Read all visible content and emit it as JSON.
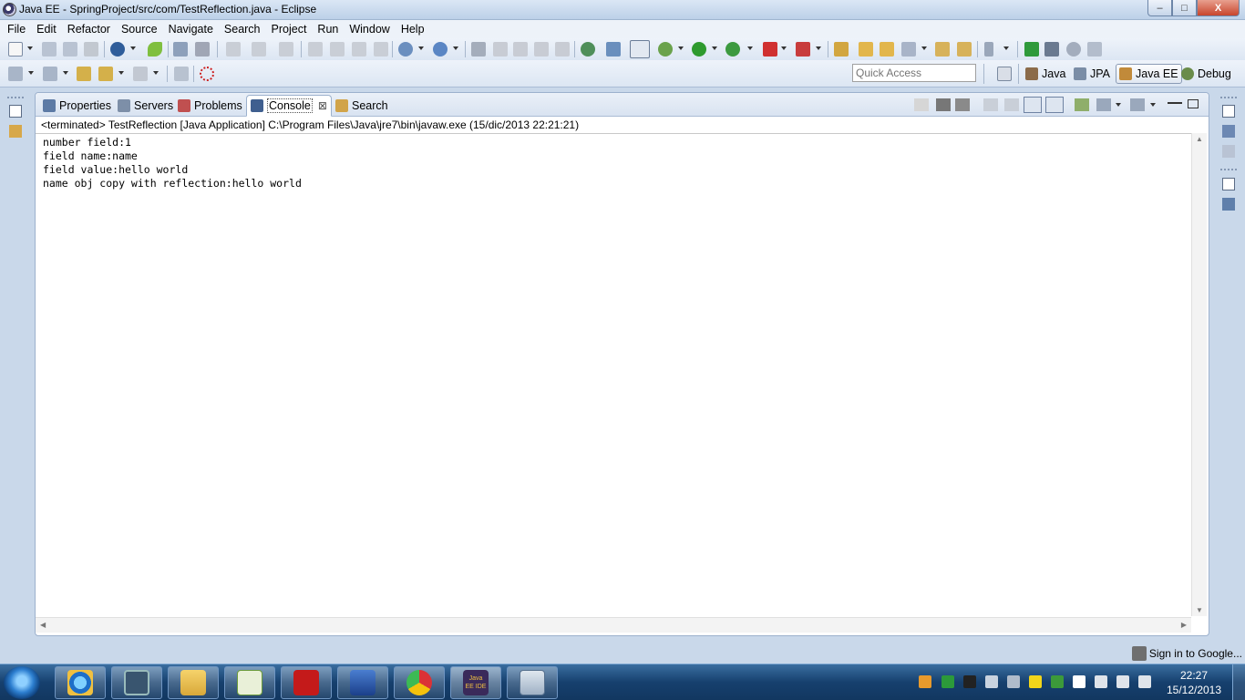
{
  "window": {
    "title": "Java EE - SpringProject/src/com/TestReflection.java - Eclipse",
    "controls": {
      "minimize": "–",
      "maximize": "□",
      "close": "X"
    }
  },
  "menu": [
    "File",
    "Edit",
    "Refactor",
    "Source",
    "Navigate",
    "Search",
    "Project",
    "Run",
    "Window",
    "Help"
  ],
  "toolbar": {
    "quick_access_placeholder": "Quick Access",
    "perspectives": [
      {
        "label": "Java",
        "icon": "java-perspective-icon",
        "active": false
      },
      {
        "label": "JPA",
        "icon": "jpa-perspective-icon",
        "active": false
      },
      {
        "label": "Java EE",
        "icon": "javaee-perspective-icon",
        "active": true
      },
      {
        "label": "Debug",
        "icon": "debug-perspective-icon",
        "active": false
      }
    ]
  },
  "views": {
    "tabs": [
      {
        "label": "Properties",
        "icon": "properties-icon",
        "active": false
      },
      {
        "label": "Servers",
        "icon": "servers-icon",
        "active": false
      },
      {
        "label": "Problems",
        "icon": "problems-icon",
        "active": false
      },
      {
        "label": "Console",
        "icon": "console-icon",
        "active": true
      },
      {
        "label": "Search",
        "icon": "search-icon",
        "active": false
      }
    ],
    "tab_close_glyph": "⊠"
  },
  "console": {
    "header": "<terminated> TestReflection [Java Application] C:\\Program Files\\Java\\jre7\\bin\\javaw.exe (15/dic/2013 22:21:21)",
    "lines": [
      "number field:1",
      "field name:name",
      "field value:hello world",
      "name obj copy with reflection:hello world"
    ]
  },
  "status": {
    "google_signin": "Sign in to Google..."
  },
  "taskbar": {
    "apps": [
      "internet-explorer-icon",
      "remote-desktop-icon",
      "file-explorer-icon",
      "notepad-plus-icon",
      "adobe-reader-icon",
      "network-icon",
      "chrome-icon",
      "eclipse-javaee-icon",
      "calculator-icon"
    ],
    "eclipse_label": "Java EE IDE",
    "clock_time": "22:27",
    "clock_date": "15/12/2013"
  },
  "colors": {
    "accent": "#3a6ea0",
    "panel_border": "#9cb1cd",
    "chrome_bg": "#dce6f3"
  }
}
